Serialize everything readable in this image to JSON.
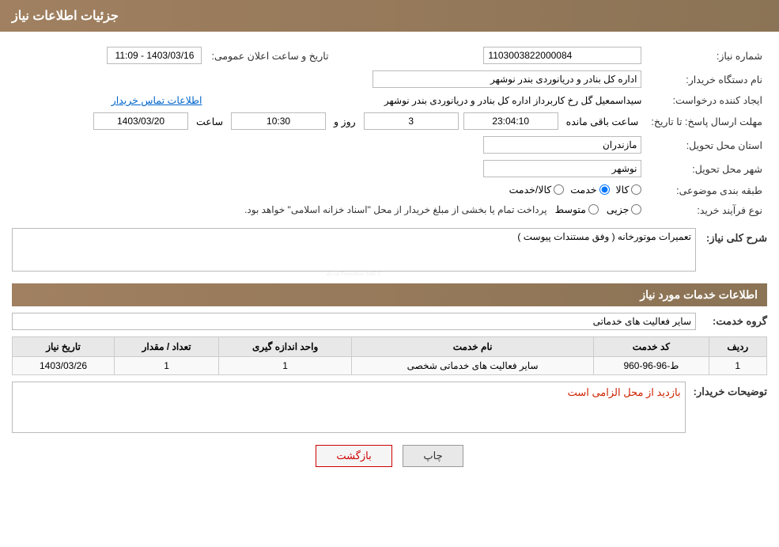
{
  "header": {
    "title": "جزئیات اطلاعات نیاز"
  },
  "fields": {
    "need_number_label": "شماره نیاز:",
    "need_number_value": "1103003822000084",
    "buyer_org_label": "نام دستگاه خریدار:",
    "buyer_org_value": "اداره کل بنادر و دریانوردی بندر نوشهر",
    "announcement_date_label": "تاریخ و ساعت اعلان عمومی:",
    "announcement_date_value": "1403/03/16 - 11:09",
    "requester_label": "ایجاد کننده درخواست:",
    "requester_value": "سیداسمعیل گل رخ کاربرداز اداره کل بنادر و دریانوردی بندر نوشهر",
    "requester_contact_link": "اطلاعات تماس خریدار",
    "response_deadline_label": "مهلت ارسال پاسخ: تا تاریخ:",
    "response_date": "1403/03/20",
    "response_time_label": "ساعت",
    "response_time": "10:30",
    "response_days_label": "روز و",
    "response_days": "3",
    "response_remaining_label": "ساعت باقی مانده",
    "response_remaining": "23:04:10",
    "province_label": "استان محل تحویل:",
    "province_value": "مازندران",
    "city_label": "شهر محل تحویل:",
    "city_value": "نوشهر",
    "category_label": "طبقه بندی موضوعی:",
    "category_options": [
      "کالا",
      "خدمت",
      "کالا/خدمت"
    ],
    "category_selected": "خدمت",
    "purchase_type_label": "نوع فرآیند خرید:",
    "purchase_options": [
      "جزیی",
      "متوسط"
    ],
    "purchase_note": "پرداخت تمام یا بخشی از مبلغ خریدار از محل \"اسناد خزانه اسلامی\" خواهد بود.",
    "need_desc_label": "شرح کلی نیاز:",
    "need_desc_value": "تعمیرات موتورخانه ( وفق مستندات پیوست )",
    "service_info_header": "اطلاعات خدمات مورد نیاز",
    "service_group_label": "گروه خدمت:",
    "service_group_value": "سایر فعالیت های خدماتی",
    "table": {
      "headers": [
        "ردیف",
        "کد خدمت",
        "نام خدمت",
        "واحد اندازه گیری",
        "تعداد / مقدار",
        "تاریخ نیاز"
      ],
      "rows": [
        {
          "row": "1",
          "service_code": "ط-96-96-960",
          "service_name": "سایر فعالیت های خدماتی شخصی",
          "unit": "1",
          "quantity": "1",
          "date": "1403/03/26"
        }
      ]
    },
    "buyer_notes_label": "توضیحات خریدار:",
    "buyer_notes_value": "بازدید از محل الزامی است"
  },
  "buttons": {
    "print": "چاپ",
    "back": "بازگشت"
  }
}
